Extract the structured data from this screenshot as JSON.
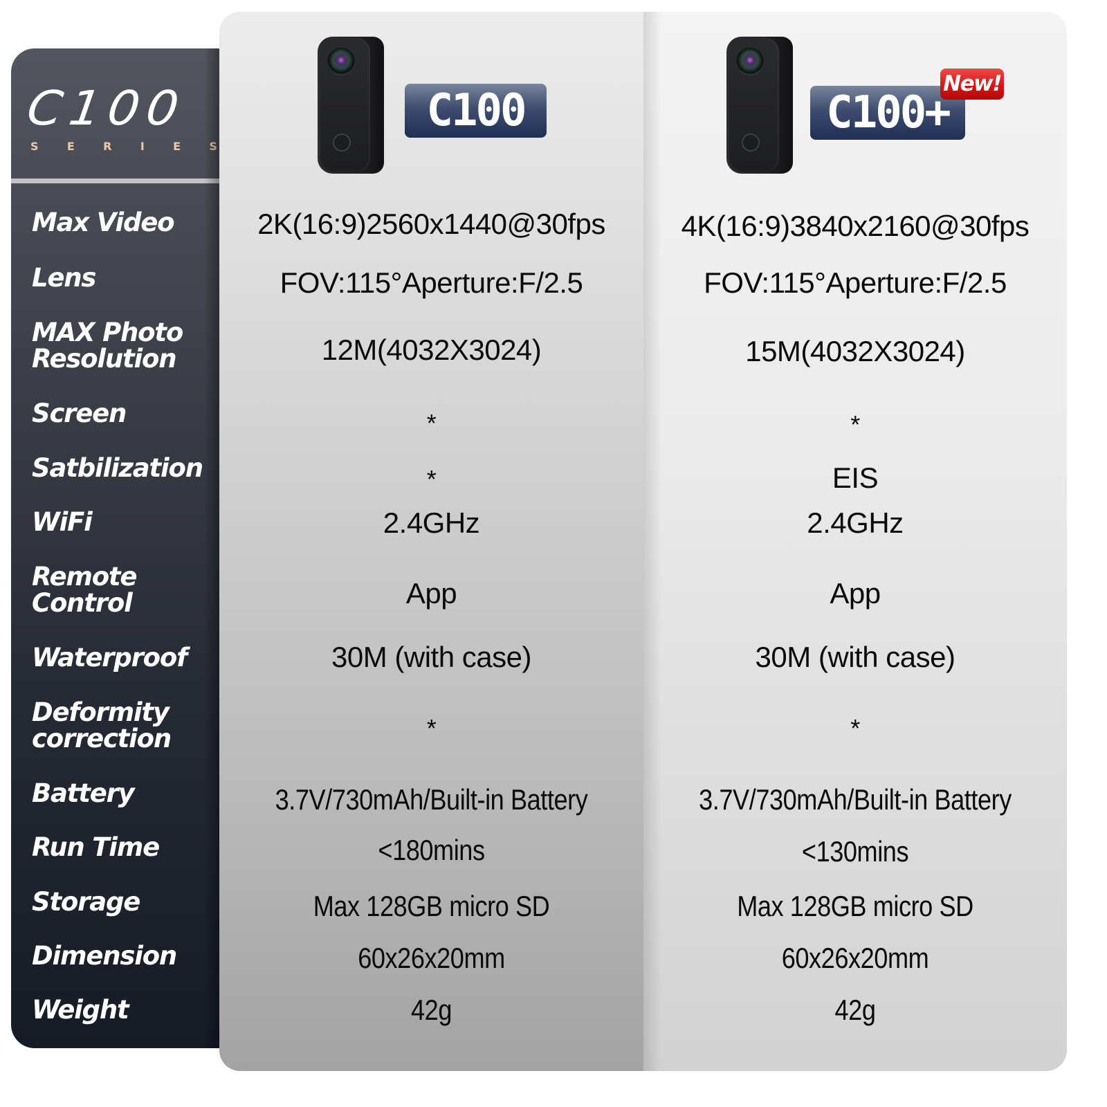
{
  "brand": {
    "title": "C100",
    "subtitle_letters": [
      "S",
      "E",
      "R",
      "I",
      "E",
      "S"
    ],
    "subtitle": "SERIES",
    "colors": {
      "label_panel": "#2a2e38",
      "subtitle_accent": "#f0c9a4",
      "badge_blue": "#2c3b60",
      "new_badge_red": "#d91414"
    }
  },
  "spec_labels": [
    [
      "Max Video"
    ],
    [
      "Lens"
    ],
    [
      "MAX Photo",
      "Resolution"
    ],
    [
      "Screen"
    ],
    [
      "Satbilization"
    ],
    [
      "WiFi"
    ],
    [
      "Remote",
      "Control"
    ],
    [
      "Waterproof"
    ],
    [
      "Deformity",
      "correction"
    ],
    [
      "Battery"
    ],
    [
      "Run Time"
    ],
    [
      "Storage"
    ],
    [
      "Dimension"
    ],
    [
      "Weight"
    ]
  ],
  "products": [
    {
      "model": "C100",
      "image": "camera-icon",
      "new_badge": null,
      "specs": {
        "max_video": "2K(16:9)2560x1440@30fps",
        "lens": "FOV:115°Aperture:F/2.5",
        "max_photo_resolution": "12M(4032X3024)",
        "screen": "*",
        "stabilization": "*",
        "wifi": "2.4GHz",
        "remote_control": "App",
        "waterproof": "30M (with case)",
        "deformity_correction": "*",
        "battery": "3.7V/730mAh/Built-in Battery",
        "run_time": "<180mins",
        "storage": "Max 128GB micro SD",
        "dimension": "60x26x20mm",
        "weight": "42g"
      }
    },
    {
      "model": "C100+",
      "image": "camera-icon",
      "new_badge": "New!",
      "specs": {
        "max_video": "4K(16:9)3840x2160@30fps",
        "lens": "FOV:115°Aperture:F/2.5",
        "max_photo_resolution": "15M(4032X3024)",
        "screen": "*",
        "stabilization": "EIS",
        "wifi": "2.4GHz",
        "remote_control": "App",
        "waterproof": "30M (with case)",
        "deformity_correction": "*",
        "battery": "3.7V/730mAh/Built-in Battery",
        "run_time": "<130mins",
        "storage": "Max 128GB micro SD",
        "dimension": "60x26x20mm",
        "weight": "42g"
      }
    }
  ]
}
